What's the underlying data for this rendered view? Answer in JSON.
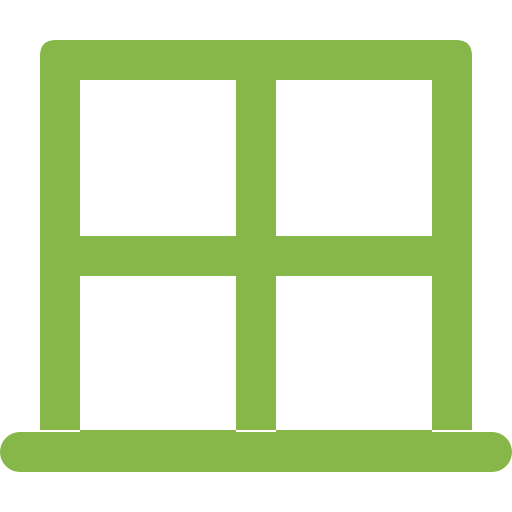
{
  "icon": {
    "name": "window-icon",
    "color": "#86B748",
    "background": "#FFFFFF"
  }
}
